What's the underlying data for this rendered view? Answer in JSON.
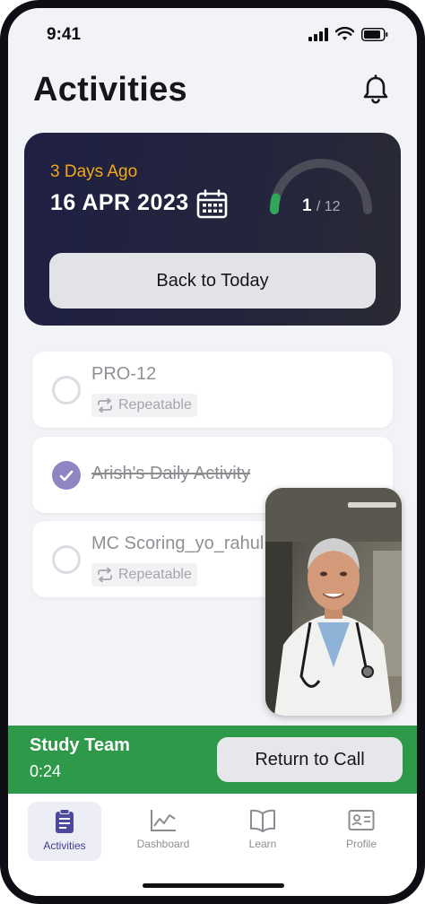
{
  "status_bar": {
    "time": "9:41"
  },
  "header": {
    "title": "Activities"
  },
  "date_card": {
    "relative": "3 Days Ago",
    "date": "16 APR 2023",
    "progress": {
      "current": "1",
      "total": "/ 12",
      "fraction": 0.0833
    },
    "back_label": "Back to Today"
  },
  "activities": [
    {
      "name": "PRO-12",
      "tag": "Repeatable",
      "done": false
    },
    {
      "name": "Arish's Daily Activity",
      "done": true
    },
    {
      "name": "MC Scoring_yo_rahul",
      "tag": "Repeatable",
      "done": false
    }
  ],
  "call": {
    "team": "Study Team",
    "duration": "0:24",
    "return_label": "Return to Call"
  },
  "nav": {
    "items": [
      {
        "label": "Activities",
        "icon": "clipboard-icon",
        "active": true
      },
      {
        "label": "Dashboard",
        "icon": "chart-icon",
        "active": false
      },
      {
        "label": "Learn",
        "icon": "book-icon",
        "active": false
      },
      {
        "label": "Profile",
        "icon": "id-card-icon",
        "active": false
      }
    ]
  },
  "colors": {
    "accent_orange": "#f3a817",
    "progress_green": "#2fa85b",
    "call_green": "#2e9a49",
    "nav_active": "#3e3c91",
    "card_navy": "#1f2043"
  }
}
